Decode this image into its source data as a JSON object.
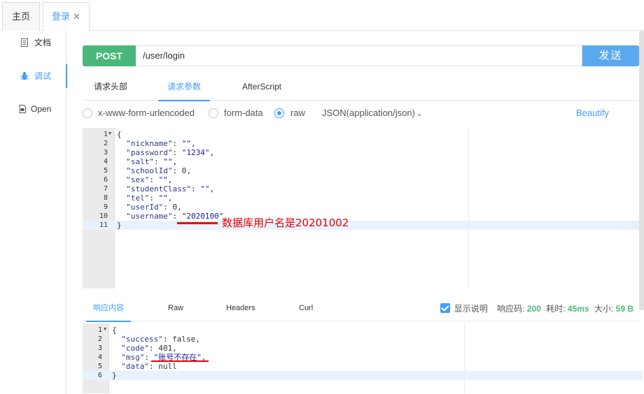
{
  "tabs": {
    "home": "主页",
    "login": "登录",
    "close": "✕"
  },
  "sidebar": {
    "items": [
      {
        "label": "文档",
        "icon": "document-icon"
      },
      {
        "label": "调试",
        "icon": "bug-icon"
      },
      {
        "label": "Open",
        "icon": "file-icon"
      }
    ]
  },
  "request": {
    "method": "POST",
    "url": "/user/login",
    "send_label": "发送",
    "tabs": [
      "请求头部",
      "请求参数",
      "AfterScript"
    ],
    "active_tab": "请求参数",
    "body_types": [
      "x-www-form-urlencoded",
      "form-data",
      "raw"
    ],
    "selected_body_type": "raw",
    "content_type": "JSON(application/json)",
    "beautify_label": "Beautify",
    "code_lines": [
      "{",
      "  \"nickname\": \"\",",
      "  \"password\": \"1234\",",
      "  \"salt\": \"\",",
      "  \"schoolId\": 0,",
      "  \"sex\": \"\",",
      "  \"studentClass\": \"\",",
      "  \"tel\": \"\",",
      "  \"userId\": 0,",
      "  \"username\": \"2020100\"",
      "}"
    ],
    "annotation": "数据库用户名是20201002"
  },
  "response": {
    "tabs": [
      "响应内容",
      "Raw",
      "Headers",
      "Curl"
    ],
    "active_tab": "响应内容",
    "show_desc_label": "显示说明",
    "status_label": "响应码:",
    "status_value": "200",
    "time_label": "耗时:",
    "time_value": "45ms",
    "size_label": "大小:",
    "size_value": "59 B",
    "code_lines": [
      "{",
      "  \"success\": false,",
      "  \"code\": 401,",
      "  \"msg\": \"账号不存在\",",
      "  \"data\": null",
      "}"
    ]
  },
  "colors": {
    "accent": "#409eff",
    "post": "#49b87a",
    "annotation": "#e00000"
  }
}
